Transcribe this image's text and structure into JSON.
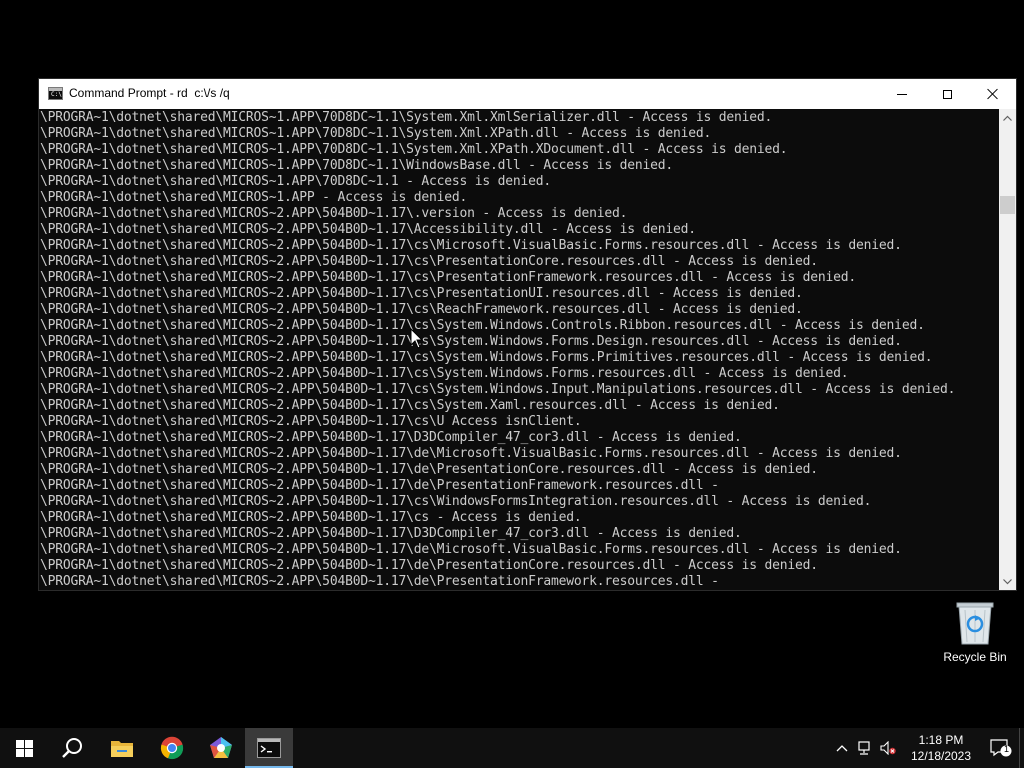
{
  "window": {
    "title": "Command Prompt - rd  c:\\/s /q",
    "icon": "cmd-icon"
  },
  "console": {
    "lines": [
      "\\PROGRA~1\\dotnet\\shared\\MICROS~1.APP\\70D8DC~1.1\\System.Xml.XmlSerializer.dll - Access is denied.",
      "\\PROGRA~1\\dotnet\\shared\\MICROS~1.APP\\70D8DC~1.1\\System.Xml.XPath.dll - Access is denied.",
      "\\PROGRA~1\\dotnet\\shared\\MICROS~1.APP\\70D8DC~1.1\\System.Xml.XPath.XDocument.dll - Access is denied.",
      "\\PROGRA~1\\dotnet\\shared\\MICROS~1.APP\\70D8DC~1.1\\WindowsBase.dll - Access is denied.",
      "\\PROGRA~1\\dotnet\\shared\\MICROS~1.APP\\70D8DC~1.1 - Access is denied.",
      "\\PROGRA~1\\dotnet\\shared\\MICROS~1.APP - Access is denied.",
      "\\PROGRA~1\\dotnet\\shared\\MICROS~2.APP\\504B0D~1.17\\.version - Access is denied.",
      "\\PROGRA~1\\dotnet\\shared\\MICROS~2.APP\\504B0D~1.17\\Accessibility.dll - Access is denied.",
      "\\PROGRA~1\\dotnet\\shared\\MICROS~2.APP\\504B0D~1.17\\cs\\Microsoft.VisualBasic.Forms.resources.dll - Access is denied.",
      "\\PROGRA~1\\dotnet\\shared\\MICROS~2.APP\\504B0D~1.17\\cs\\PresentationCore.resources.dll - Access is denied.",
      "\\PROGRA~1\\dotnet\\shared\\MICROS~2.APP\\504B0D~1.17\\cs\\PresentationFramework.resources.dll - Access is denied.",
      "\\PROGRA~1\\dotnet\\shared\\MICROS~2.APP\\504B0D~1.17\\cs\\PresentationUI.resources.dll - Access is denied.",
      "\\PROGRA~1\\dotnet\\shared\\MICROS~2.APP\\504B0D~1.17\\cs\\ReachFramework.resources.dll - Access is denied.",
      "\\PROGRA~1\\dotnet\\shared\\MICROS~2.APP\\504B0D~1.17\\cs\\System.Windows.Controls.Ribbon.resources.dll - Access is denied.",
      "\\PROGRA~1\\dotnet\\shared\\MICROS~2.APP\\504B0D~1.17\\cs\\System.Windows.Forms.Design.resources.dll - Access is denied.",
      "\\PROGRA~1\\dotnet\\shared\\MICROS~2.APP\\504B0D~1.17\\cs\\System.Windows.Forms.Primitives.resources.dll - Access is denied.",
      "\\PROGRA~1\\dotnet\\shared\\MICROS~2.APP\\504B0D~1.17\\cs\\System.Windows.Forms.resources.dll - Access is denied.",
      "\\PROGRA~1\\dotnet\\shared\\MICROS~2.APP\\504B0D~1.17\\cs\\System.Windows.Input.Manipulations.resources.dll - Access is denied.",
      "\\PROGRA~1\\dotnet\\shared\\MICROS~2.APP\\504B0D~1.17\\cs\\System.Xaml.resources.dll - Access is denied.",
      "\\PROGRA~1\\dotnet\\shared\\MICROS~2.APP\\504B0D~1.17\\cs\\U Access isnClient.",
      "\\PROGRA~1\\dotnet\\shared\\MICROS~2.APP\\504B0D~1.17\\D3DCompiler_47_cor3.dll - Access is denied.",
      "\\PROGRA~1\\dotnet\\shared\\MICROS~2.APP\\504B0D~1.17\\de\\Microsoft.VisualBasic.Forms.resources.dll - Access is denied.",
      "\\PROGRA~1\\dotnet\\shared\\MICROS~2.APP\\504B0D~1.17\\de\\PresentationCore.resources.dll - Access is denied.",
      "\\PROGRA~1\\dotnet\\shared\\MICROS~2.APP\\504B0D~1.17\\de\\PresentationFramework.resources.dll -",
      "\\PROGRA~1\\dotnet\\shared\\MICROS~2.APP\\504B0D~1.17\\cs\\WindowsFormsIntegration.resources.dll - Access is denied.",
      "\\PROGRA~1\\dotnet\\shared\\MICROS~2.APP\\504B0D~1.17\\cs - Access is denied.",
      "\\PROGRA~1\\dotnet\\shared\\MICROS~2.APP\\504B0D~1.17\\D3DCompiler_47_cor3.dll - Access is denied.",
      "\\PROGRA~1\\dotnet\\shared\\MICROS~2.APP\\504B0D~1.17\\de\\Microsoft.VisualBasic.Forms.resources.dll - Access is denied.",
      "\\PROGRA~1\\dotnet\\shared\\MICROS~2.APP\\504B0D~1.17\\de\\PresentationCore.resources.dll - Access is denied.",
      "\\PROGRA~1\\dotnet\\shared\\MICROS~2.APP\\504B0D~1.17\\de\\PresentationFramework.resources.dll -"
    ]
  },
  "desktop": {
    "recycle_bin_label": "Recycle Bin"
  },
  "taskbar": {
    "time": "1:18 PM",
    "date": "12/18/2023",
    "notification_count": "1",
    "accent": "#76b9ed"
  }
}
